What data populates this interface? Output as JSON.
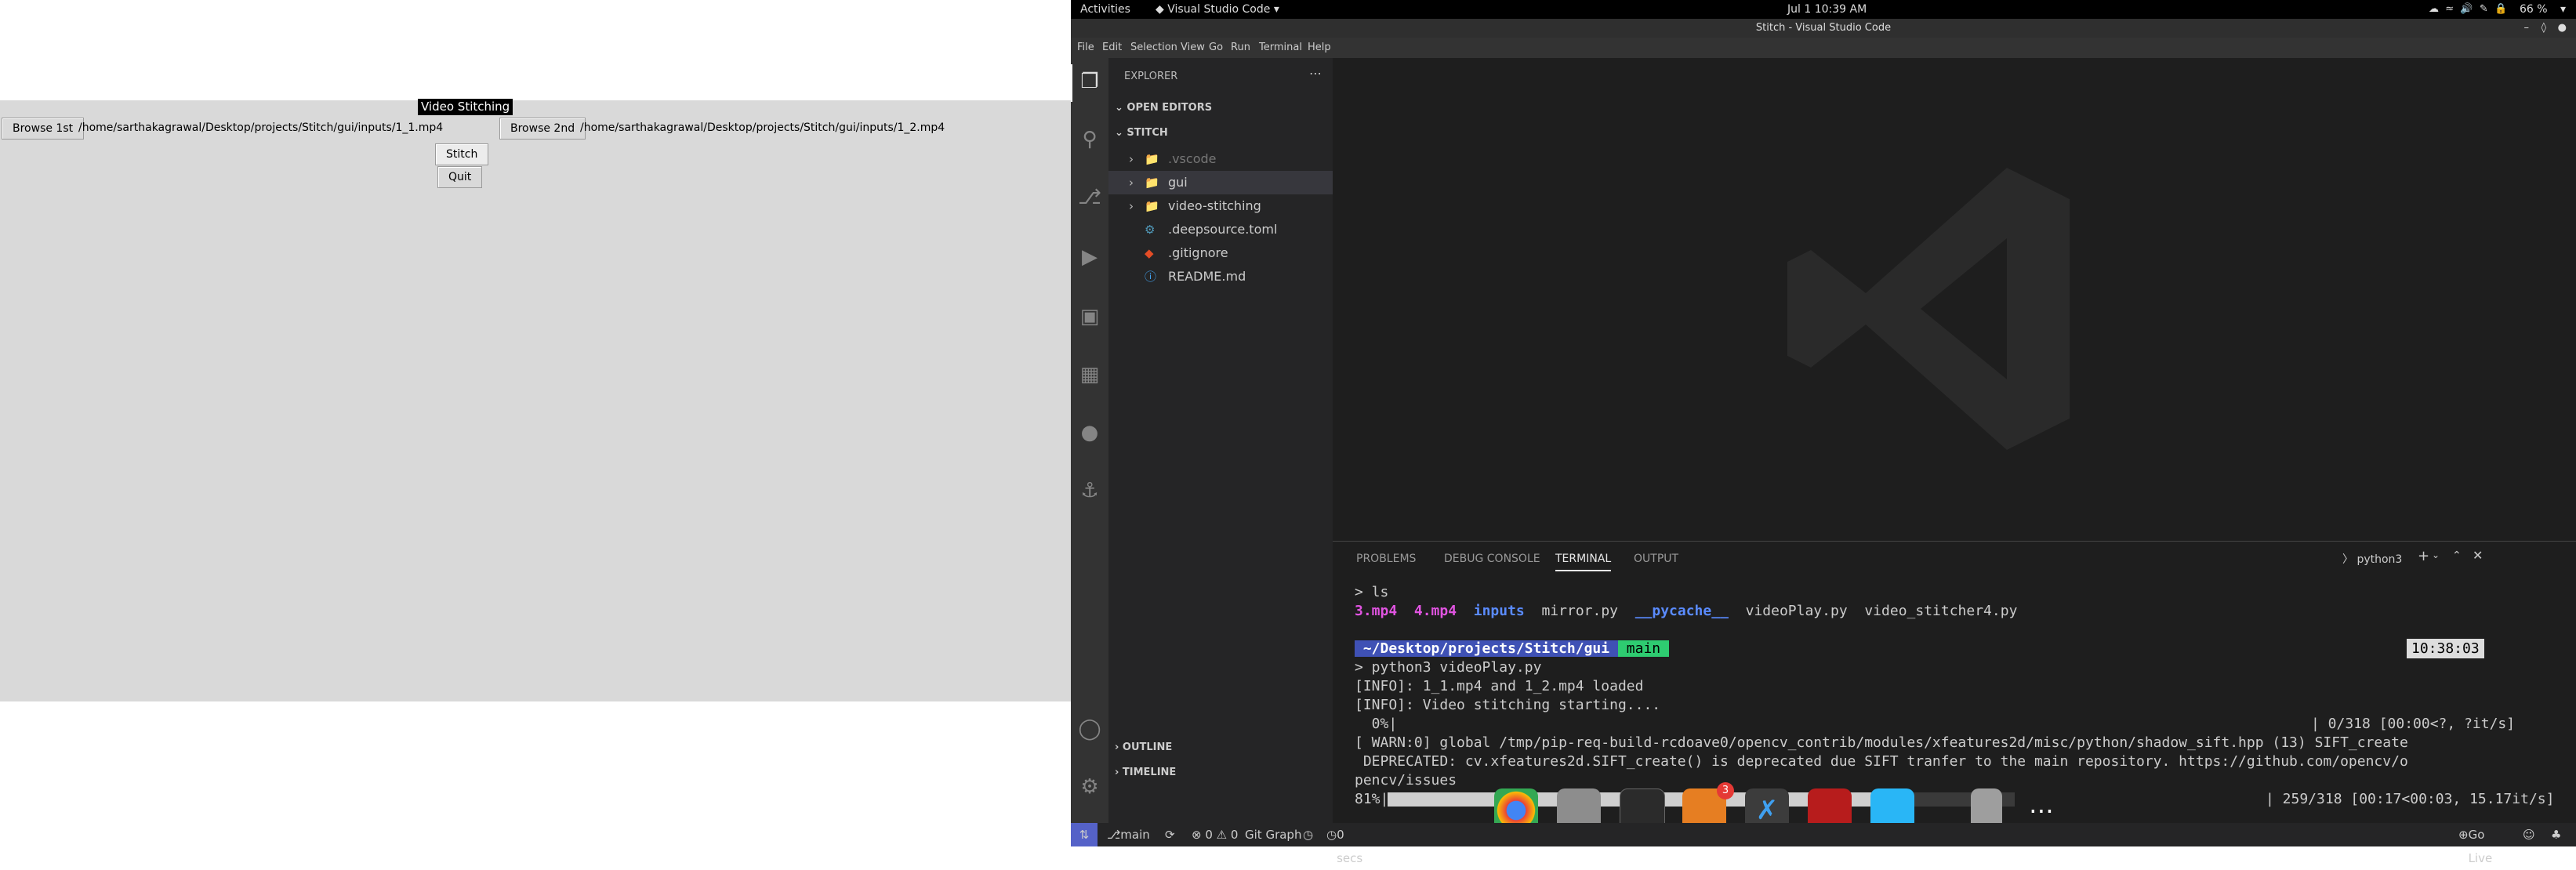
{
  "tk": {
    "title": "Video Stitching",
    "browse1_label": "Browse 1st",
    "path1": "/home/sarthakagrawal/Desktop/projects/Stitch/gui/inputs/1_1.mp4",
    "browse2_label": "Browse 2nd",
    "path2": "/home/sarthakagrawal/Desktop/projects/Stitch/gui/inputs/1_2.mp4",
    "stitch_label": "Stitch",
    "quit_label": "Quit"
  },
  "topbar": {
    "activities": "Activities",
    "app": "Visual Studio Code",
    "clock": "Jul 1  10:39 AM",
    "battery": "66 %"
  },
  "window_title": "Stitch - Visual Studio Code",
  "menu": [
    "File",
    "Edit",
    "Selection",
    "View",
    "Go",
    "Run",
    "Terminal",
    "Help"
  ],
  "explorer": {
    "header": "EXPLORER",
    "open_editors": "OPEN EDITORS",
    "folder": "STITCH",
    "items": [
      ".vscode",
      "gui",
      "video-stitching",
      ".deepsource.toml",
      ".gitignore",
      "README.md"
    ],
    "outline": "OUTLINE",
    "timeline": "TIMELINE"
  },
  "panel": {
    "tabs": [
      "PROBLEMS",
      "DEBUG CONSOLE",
      "TERMINAL",
      "OUTPUT"
    ],
    "shell": "python3"
  },
  "terminal": {
    "cmd1": "> ls",
    "ls_files": [
      "3.mp4",
      "4.mp4",
      "inputs",
      "mirror.py",
      "__pycache__",
      "videoPlay.py",
      "video_stitcher4.py"
    ],
    "prompt_path": " ~/Desktop/projects/Stitch/gui ",
    "prompt_branch": " main ",
    "prompt_time": "10:38:03",
    "cmd2": "> python3 videoPlay.py",
    "line1": "[INFO]: 1_1.mp4 and 1_2.mp4 loaded",
    "line2": "[INFO]: Video stitching starting....",
    "line3a": "  0%|",
    "line3b": "| 0/318 [00:00<?, ?it/s]",
    "line4": "[ WARN:0] global /tmp/pip-req-build-rcdoave0/opencv_contrib/modules/xfeatures2d/misc/python/shadow_sift.hpp (13) SIFT_create",
    "line5": " DEPRECATED: cv.xfeatures2d.SIFT_create() is deprecated due SIFT tranfer to the main repository. https://github.com/opencv/o",
    "line6": "pencv/issues",
    "progress_pct": "81%|",
    "progress_fraction": 0.81,
    "progress_tail": "| 259/318 [00:17<00:03, 15.17it/s]"
  },
  "status": {
    "branch": "main",
    "problems": "⊗ 0 ⚠ 0",
    "git_graph": "Git Graph",
    "secs": "0 secs",
    "go_live": "Go Live"
  },
  "dock_badge": "3"
}
